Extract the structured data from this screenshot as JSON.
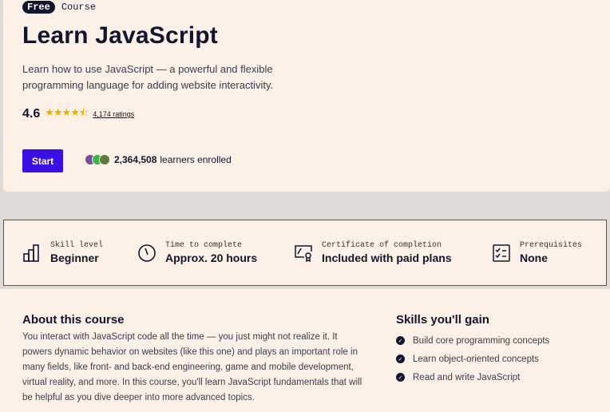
{
  "hero": {
    "badge": "Free",
    "type": "Course",
    "title": "Learn JavaScript",
    "description": "Learn how to use JavaScript — a powerful and flexible programming language for adding website interactivity.",
    "rating": "4.6",
    "stars": "★★★★⯪",
    "rating_value": 4.6,
    "ratings_link": "4,174 ratings",
    "start_label": "Start",
    "learners_count": "2,364,508",
    "learners_label": "learners enrolled"
  },
  "info": [
    {
      "label": "Skill level",
      "value": "Beginner",
      "icon": "bar-chart-icon"
    },
    {
      "label": "Time to complete",
      "value": "Approx. 20 hours",
      "icon": "clock-icon"
    },
    {
      "label": "Certificate of completion",
      "value": "Included with paid plans",
      "icon": "certificate-icon"
    },
    {
      "label": "Prerequisites",
      "value": "None",
      "icon": "checklist-icon"
    }
  ],
  "about": {
    "title": "About this course",
    "text": "You interact with JavaScript code all the time — you just might not realize it. It powers dynamic behavior on websites (like this one) and plays an important role in many fields, like front- and back-end engineering, game and mobile development, virtual reality, and more. In this course, you'll learn JavaScript fundamentals that will be helpful as you dive deeper into more advanced topics."
  },
  "skills": {
    "title": "Skills you'll gain",
    "items": [
      "Build core programming concepts",
      "Learn object-oriented concepts",
      "Read and write JavaScript"
    ]
  },
  "colors": {
    "accent": "#3a10e5",
    "ink": "#10162f",
    "background": "#fdf0e6",
    "star": "#e9b200"
  }
}
